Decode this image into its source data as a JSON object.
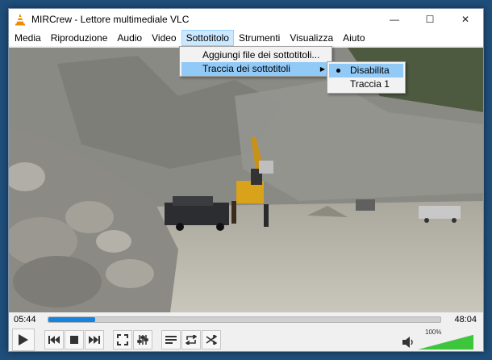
{
  "window": {
    "title": "MIRCrew - Lettore multimediale VLC",
    "controls": {
      "minimize": "—",
      "maximize": "☐",
      "close": "✕"
    }
  },
  "menubar": {
    "items": [
      "Media",
      "Riproduzione",
      "Audio",
      "Video",
      "Sottotitolo",
      "Strumenti",
      "Visualizza",
      "Aiuto"
    ],
    "active": "Sottotitolo"
  },
  "subtitle_menu": {
    "items": [
      {
        "label": "Aggiungi file dei sottotitoli..."
      },
      {
        "label": "Traccia dei sottotitoli"
      }
    ],
    "highlighted": "Traccia dei sottotitoli"
  },
  "subtitle_track_menu": {
    "items": [
      {
        "label": "Disabilita"
      },
      {
        "label": "Traccia 1"
      }
    ],
    "selected": "Disabilita"
  },
  "playback": {
    "elapsed": "05:44",
    "total": "48:04",
    "progress_fraction": 0.12
  },
  "volume": {
    "label": "100%",
    "level_fraction": 1.0
  },
  "icons": {
    "play": "play-icon",
    "prev": "previous-icon",
    "stop": "stop-icon",
    "next": "next-icon",
    "fullscreen": "fullscreen-icon",
    "extended": "extended-settings-icon",
    "playlist": "playlist-icon",
    "loop": "loop-icon",
    "shuffle": "shuffle-icon",
    "speaker": "speaker-icon"
  },
  "colors": {
    "accent": "#1583e0",
    "menu_highlight": "#91c9f7",
    "volume_green": "#3cc63c"
  }
}
